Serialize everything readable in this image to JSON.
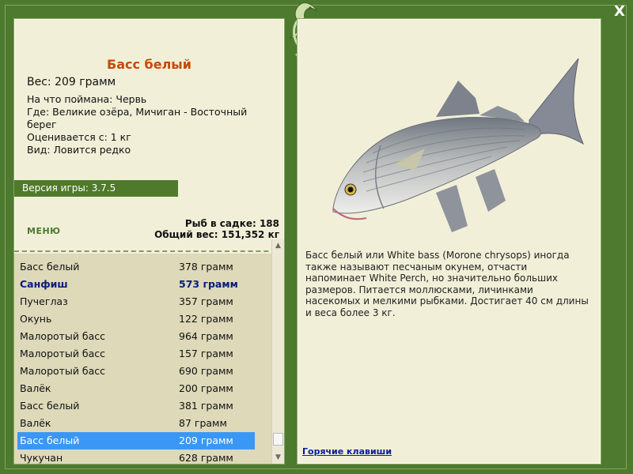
{
  "window": {
    "close_label": "X"
  },
  "catch": {
    "title": "Басс белый",
    "weight": "Вес: 209 грамм",
    "caught_with": "На что поймана: Червь",
    "location": "Где: Великие озёра, Мичиган - Восточный берег",
    "valued_from": "Оценивается с: 1 кг",
    "kind": "Вид: Ловится редко"
  },
  "version_label": "Версия игры: 3.7.5",
  "menu_label": "МЕНЮ",
  "stats": {
    "fish_in_keepnet": "Рыб в садке: 188",
    "total_weight": "Общий вес: 151,352 кг"
  },
  "fish_list": [
    {
      "name": "Басс белый",
      "weight": "378 грамм",
      "style": "normal"
    },
    {
      "name": "Санфиш",
      "weight": "573 грамм",
      "style": "bold"
    },
    {
      "name": "Пучеглаз",
      "weight": "357 грамм",
      "style": "normal"
    },
    {
      "name": "Окунь",
      "weight": "122 грамм",
      "style": "normal"
    },
    {
      "name": "Малоротый басс",
      "weight": "964 грамм",
      "style": "normal"
    },
    {
      "name": "Малоротый басс",
      "weight": "157 грамм",
      "style": "normal"
    },
    {
      "name": "Малоротый басс",
      "weight": "690 грамм",
      "style": "normal"
    },
    {
      "name": "Валёк",
      "weight": "200 грамм",
      "style": "normal"
    },
    {
      "name": "Басс белый",
      "weight": "381 грамм",
      "style": "normal"
    },
    {
      "name": "Валёк",
      "weight": "87 грамм",
      "style": "normal"
    },
    {
      "name": "Басс белый",
      "weight": "209 грамм",
      "style": "selected"
    },
    {
      "name": "Чукучан",
      "weight": "628 грамм",
      "style": "normal"
    }
  ],
  "description": "Басс белый или White bass (Morone chrysops) иногда также называют песчаным окунем, отчасти напоминает White Perch, но значительно больших размеров. Питается моллюсками, личинками насекомых и мелкими рыбками. Достигает 40 см длины и веса более 3 кг.",
  "hotkeys_label": "Горячие клавиши",
  "icons": {
    "close": "close-icon",
    "logo": "lizard-logo-icon",
    "scroll_up": "scroll-up-arrow-icon",
    "scroll_down": "scroll-down-arrow-icon"
  },
  "colors": {
    "frame": "#4d7a2f",
    "panel": "#f2efd8",
    "list_bg": "#ddd9b9",
    "title": "#c34a06",
    "selected": "#3b97f5",
    "bold_row": "#0a1c7a",
    "link": "#0a1c9a"
  }
}
